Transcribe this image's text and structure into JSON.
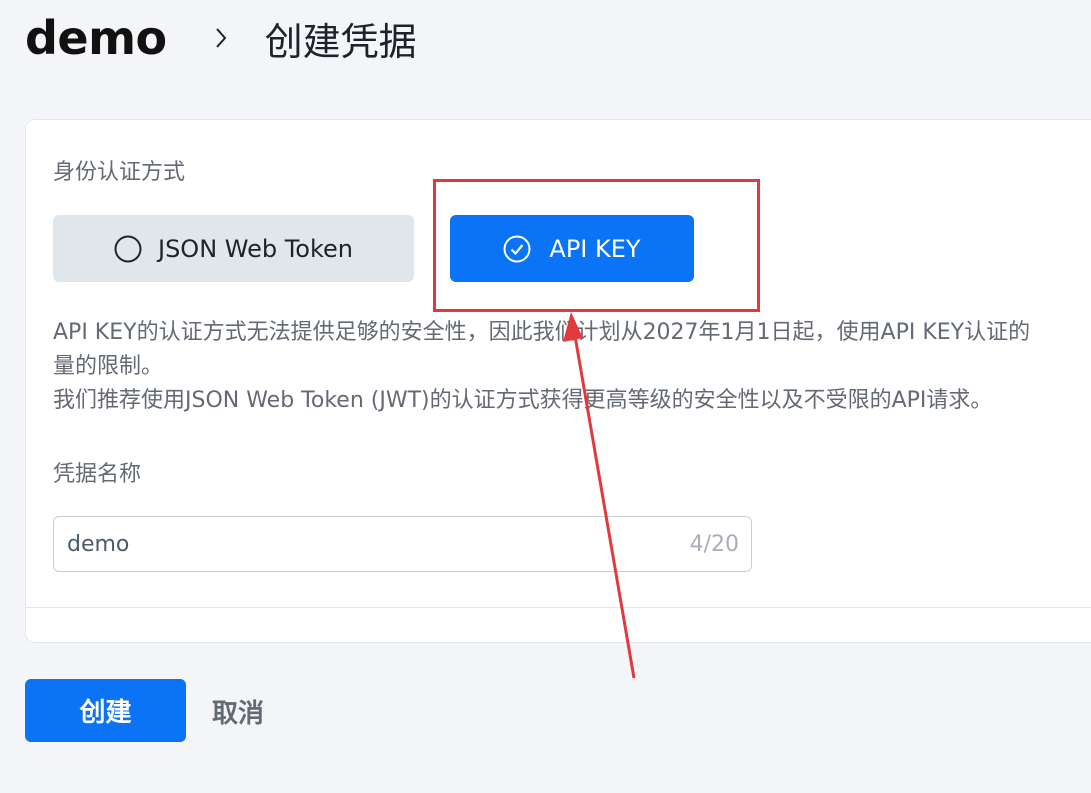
{
  "header": {
    "breadcrumb_root": "demo",
    "page_title": "创建凭据"
  },
  "form": {
    "auth_label": "身份认证方式",
    "auth_options": [
      {
        "label": "JSON Web Token",
        "selected": false
      },
      {
        "label": "API KEY",
        "selected": true
      }
    ],
    "notice_lines": [
      "API KEY的认证方式无法提供足够的安全性，因此我们计划从2027年1月1日起，使用API KEY认证的",
      "量的限制。",
      "我们推荐使用JSON Web Token (JWT)的认证方式获得更高等级的安全性以及不受限的API请求。"
    ],
    "name_label": "凭据名称",
    "name_value": "demo",
    "name_counter": "4/20"
  },
  "actions": {
    "create_label": "创建",
    "cancel_label": "取消"
  },
  "colors": {
    "primary": "#0b73f5",
    "annotation": "#e0393e"
  }
}
